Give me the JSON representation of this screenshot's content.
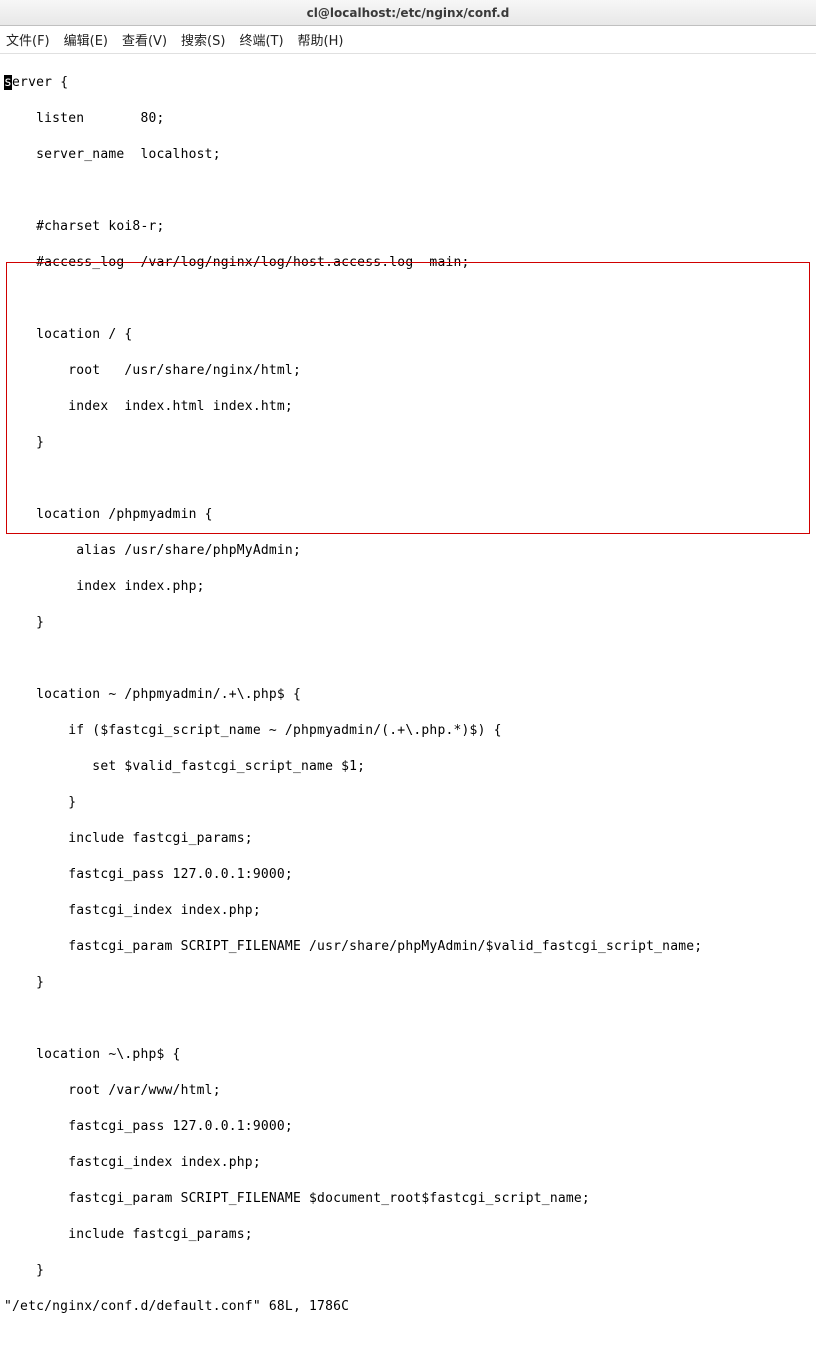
{
  "title": "cl@localhost:/etc/nginx/conf.d",
  "menu": {
    "file": "文件(F)",
    "edit": "编辑(E)",
    "view": "查看(V)",
    "search": "搜索(S)",
    "terminal": "终端(T)",
    "help": "帮助(H)"
  },
  "editor": {
    "cursor_char": "s",
    "line1_rest": "erver {",
    "line2": "    listen       80;",
    "line3": "    server_name  localhost;",
    "blank": " ",
    "line5": "    #charset koi8-r;",
    "line6": "    #access_log  /var/log/nginx/log/host.access.log  main;",
    "line8": "    location / {",
    "line9": "        root   /usr/share/nginx/html;",
    "line10": "        index  index.html index.htm;",
    "line11": "    }",
    "line13": "    location /phpmyadmin {",
    "line14": "         alias /usr/share/phpMyAdmin;",
    "line15": "         index index.php;",
    "line16": "    }",
    "line18": "    location ~ /phpmyadmin/.+\\.php$ {",
    "line19": "        if ($fastcgi_script_name ~ /phpmyadmin/(.+\\.php.*)$) {",
    "line20": "           set $valid_fastcgi_script_name $1;",
    "line21": "        }",
    "line22": "        include fastcgi_params;",
    "line23": "        fastcgi_pass 127.0.0.1:9000;",
    "line24": "        fastcgi_index index.php;",
    "line25": "        fastcgi_param SCRIPT_FILENAME /usr/share/phpMyAdmin/$valid_fastcgi_script_name;",
    "line26": "    }",
    "line28": "    location ~\\.php$ {",
    "line29": "        root /var/www/html;",
    "line30": "        fastcgi_pass 127.0.0.1:9000;",
    "line31": "        fastcgi_index index.php;",
    "line32": "        fastcgi_param SCRIPT_FILENAME $document_root$fastcgi_script_name;",
    "line33": "        include fastcgi_params;",
    "line34": "    }",
    "status": "\"/etc/nginx/conf.d/default.conf\" 68L, 1786C"
  }
}
